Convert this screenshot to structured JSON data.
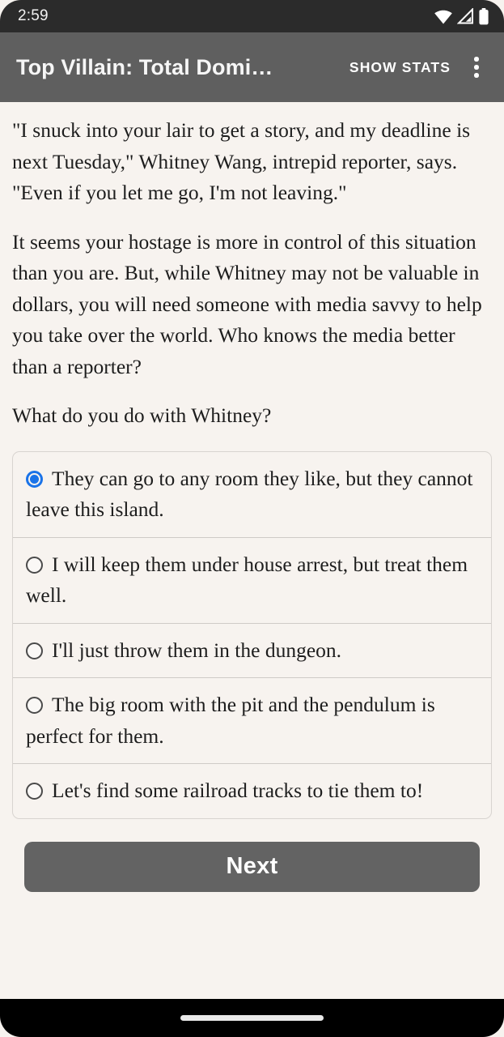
{
  "status_bar": {
    "time": "2:59",
    "icons": [
      "wifi-icon",
      "cell-signal-icon",
      "battery-icon"
    ]
  },
  "app_bar": {
    "title": "Top Villain: Total Domi…",
    "show_stats_label": "SHOW STATS",
    "overflow_icon": "more-vert-icon",
    "background_color": "#5f5f5f",
    "text_color": "#f6f6f6"
  },
  "story": {
    "paragraphs": [
      "\"I snuck into your lair to get a story, and my deadline is next Tuesday,\" Whitney Wang, intrepid reporter, says. \"Even if you let me go, I'm not leaving.\"",
      "It seems your hostage is more in control of this situation than you are. But, while Whitney may not be valuable in dollars, you will need someone with media savvy to help you take over the world. Who knows the media better than a reporter?"
    ],
    "question": "What do you do with Whitney?"
  },
  "options": [
    {
      "label": "They can go to any room they like, but they cannot leave this island.",
      "selected": true
    },
    {
      "label": "I will keep them under house arrest, but treat them well.",
      "selected": false
    },
    {
      "label": "I'll just throw them in the dungeon.",
      "selected": false
    },
    {
      "label": "The big room with the pit and the pendulum is perfect for them.",
      "selected": false
    },
    {
      "label": "Let's find some railroad tracks to tie them to!",
      "selected": false
    }
  ],
  "next_button": {
    "label": "Next",
    "background_color": "#636363",
    "text_color": "#ffffff"
  },
  "theme": {
    "page_background": "#f7f3ef",
    "body_text": "#1d1d1d",
    "accent_blue": "#1a73e8",
    "status_bar_background": "#2b2b2b",
    "gesture_bar_background": "#000000"
  }
}
